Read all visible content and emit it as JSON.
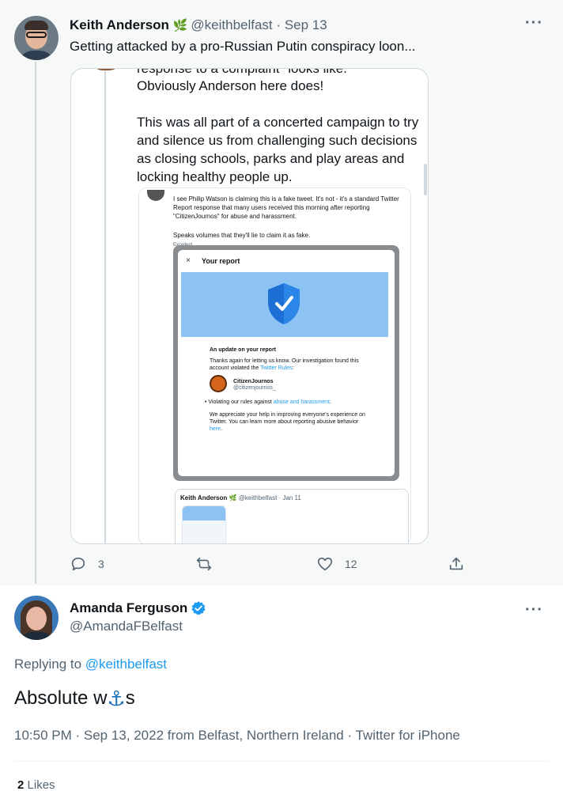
{
  "top_tweet": {
    "author_name": "Keith Anderson",
    "author_handle": "@keithbelfast",
    "separator": "·",
    "date": "Sep 13",
    "text": "Getting attacked by a pro-Russian Putin conspiracy loon...",
    "more_icon": "more-horizontal-icon",
    "embed": {
      "cut_line": "response to a complaint \"looks like.\"",
      "p1": "Obviously Anderson here does!",
      "p2": "This was all part of a concerted campaign to try and silence us from challenging such decisions as closing schools, parks and play areas and locking healthy people up.",
      "inner_tweet_text": "I see Philip Watson is claiming this is a fake tweet. It's not - it's a standard Twitter Report response that many users received this morning after reporting \"CitizenJournos\" for abuse and harassment.",
      "inner_tweet_text2": "Speaks volumes that they'll lie to claim it as fake.",
      "inner_label": "Excellent",
      "report": {
        "close": "×",
        "title": "Your report",
        "heading": "An update on your report",
        "body1_a": "Thanks again for letting us know. Our investigation found this account violated the ",
        "body1_link": "Twitter Rules",
        "body1_b": ":",
        "account_name": "CitizenJournos",
        "account_handle": "@citizenjournos_",
        "bullet_a": "Violating our rules against ",
        "bullet_link": "abuse and harassment",
        "bullet_b": ".",
        "body2_a": "We appreciate your help in improving everyone's experience on Twitter. You can learn more about reporting abusive behavior ",
        "body2_link": "here",
        "body2_b": "."
      },
      "quoted": {
        "name": "Keith Anderson",
        "handle": "@keithbelfast",
        "date": "Jan 11"
      }
    },
    "actions": {
      "replies": "3",
      "retweets": "",
      "likes": "12"
    }
  },
  "focused_tweet": {
    "author_name": "Amanda Ferguson",
    "author_handle": "@AmandaFBelfast",
    "replying_prefix": "Replying to ",
    "replying_handle": "@keithbelfast",
    "text_before": "Absolute w",
    "text_emoji": "⚓",
    "text_after": "s",
    "time": "10:50 PM",
    "date": "Sep 13, 2022",
    "location": "from Belfast, Northern Ireland",
    "client": "Twitter for iPhone",
    "likes_count": "2",
    "likes_label": "Likes"
  },
  "colors": {
    "accent": "#1d9bf0",
    "muted": "#536471",
    "text": "#0f1419",
    "top_bg": "#f7f9f9"
  }
}
